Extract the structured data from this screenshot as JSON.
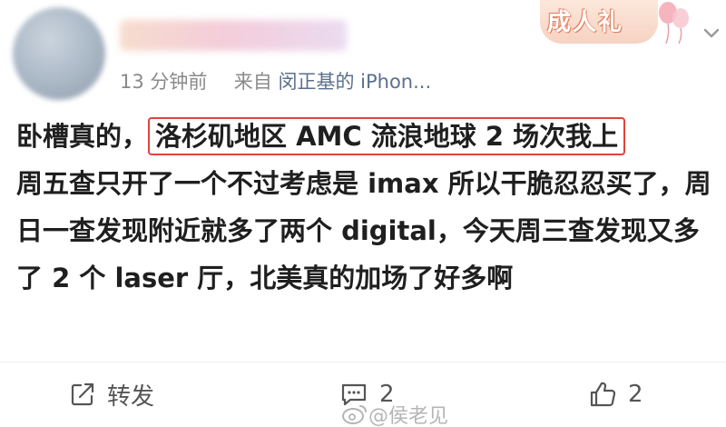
{
  "header": {
    "badge_text": "成人礼",
    "meta_time": "13 分钟前",
    "meta_from_prefix": "来自",
    "meta_source": "闵正基的 iPhon..."
  },
  "post": {
    "lead": "卧槽真的，",
    "highlight": "洛杉矶地区 AMC 流浪地球 2 场次我上",
    "rest": "周五查只开了一个不过考虑是 imax 所以干脆忍忍买了，周日一查发现附近就多了两个 digital，今天周三查发现又多了 2 个 laser 厅，北美真的加场了好多啊"
  },
  "footer": {
    "forward_label": "转发",
    "comment_count": "2",
    "like_count": "2",
    "watermark": "@侯老见"
  },
  "colors": {
    "highlight_border": "#e0443a",
    "meta_source": "#5b6f8d",
    "text": "#1f1f1f"
  }
}
